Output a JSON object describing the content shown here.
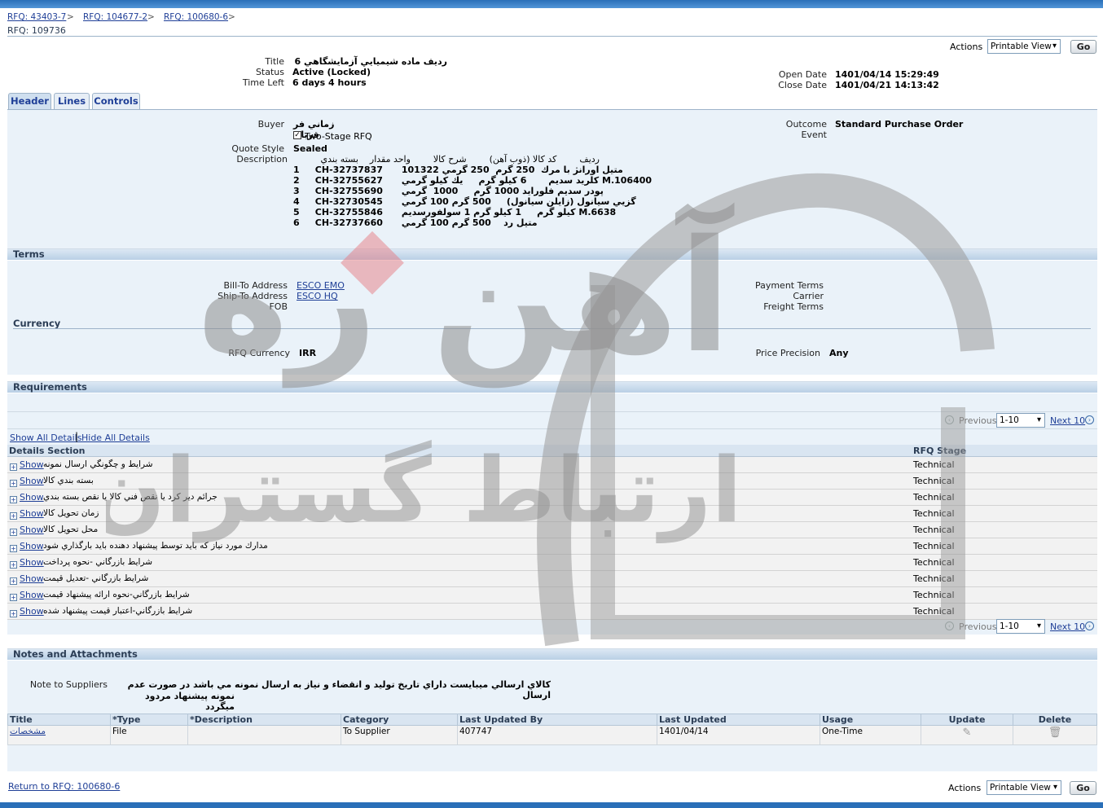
{
  "breadcrumbs": [
    "RFQ: 43403-7",
    "RFQ: 104677-2",
    "RFQ: 100680-6"
  ],
  "page_title": "RFQ: 109736",
  "actions": {
    "label": "Actions",
    "selected": "Printable View",
    "go": "Go"
  },
  "summary": {
    "title_label": "Title",
    "title": "رديف ماده شيميايي آزمايشگاهي 6",
    "status_label": "Status",
    "status": "Active (Locked)",
    "timeleft_label": "Time Left",
    "timeleft": "6 days 4 hours",
    "open_label": "Open Date",
    "open": "1401/04/14 15:29:49",
    "close_label": "Close Date",
    "close": "1401/04/21 14:13:42"
  },
  "tabs": [
    "Header",
    "Lines",
    "Controls"
  ],
  "header": {
    "buyer_label": "Buyer",
    "buyer": "زماني فر قربان",
    "two_stage": "Two-Stage RFQ",
    "quote_style_label": "Quote Style",
    "quote_style": "Sealed",
    "description_label": "Description",
    "outcome_label": "Outcome",
    "outcome": "Standard Purchase Order",
    "event_label": "Event",
    "desc_header": "رديف        كد كالا (ذوب آهن)        شرح كالا        واحد مقدار    بسته بندي",
    "desc_lines": [
      "1     CH-32737837      متيل اورانژ با مرك  250 گرم  250 گرمي 101322",
      "2     CH-32755627      كلريد سديم       6 كيلو گرم     يك كيلو گرمي M.106400",
      "3     CH-32755690      پودر سديم فلورايد 1000 گرم     1000  گرمي",
      "4     CH-32730545      گزيي سيانول (زايلن سيانول)     500 گرم 100 گرمي",
      "5     CH-32755846      كيلو گرم     1 كيلو گرم 1 سولفورسديم M.6638",
      "6     CH-32737660      متيل رد    500 گرم 100 گرمي"
    ]
  },
  "terms": {
    "section": "Terms",
    "billto_label": "Bill-To Address",
    "billto": "ESCO EMO",
    "shipto_label": "Ship-To Address",
    "shipto": "ESCO HQ",
    "fob_label": "FOB",
    "payment_label": "Payment Terms",
    "carrier_label": "Carrier",
    "freight_label": "Freight Terms",
    "currency_section": "Currency",
    "currency_label": "RFQ Currency",
    "currency": "IRR",
    "precision_label": "Price Precision",
    "precision": "Any"
  },
  "requirements": {
    "section": "Requirements",
    "previous": "Previous",
    "range": "1-10",
    "next": "Next 10",
    "show_all": "Show All Details",
    "hide_all": "Hide All Details",
    "col_details": "Details Section",
    "col_stage": "RFQ Stage",
    "show": "Show",
    "rows": [
      {
        "text": "شرايط و چگونگي ارسال نمونه",
        "stage": "Technical"
      },
      {
        "text": "بسته بندي كالا",
        "stage": "Technical"
      },
      {
        "text": "جرائم دير كرد يا نقص فني كالا يا نقص بسته بندي",
        "stage": "Technical"
      },
      {
        "text": "زمان تحويل كالا",
        "stage": "Technical"
      },
      {
        "text": "محل تحويل كالا",
        "stage": "Technical"
      },
      {
        "text": "مدارك مورد نياز كه بايد توسط پيشنهاد دهنده بايد بارگذاري شود",
        "stage": "Technical"
      },
      {
        "text": "شرايط بازرگاني -نحوه پرداخت",
        "stage": "Technical"
      },
      {
        "text": "شرايط بازرگاني -تعديل قيمت",
        "stage": "Technical"
      },
      {
        "text": "شرايط بازرگاني-نحوه ارائه پيشنهاد قيمت",
        "stage": "Technical"
      },
      {
        "text": "شرايط بازرگاني-اعتبار قيمت پيشنهاد شده",
        "stage": "Technical"
      }
    ]
  },
  "notes": {
    "section": "Notes and Attachments",
    "note_label": "Note to Suppliers",
    "note_line1": "كالاي ارسالي ميبايست داراي تاريخ توليد و انقضاء  و نياز به ارسال نمونه مي باشد در صورت عدم ارسال",
    "note_line2": "نمونه پيشنهاد مردود ميگردد",
    "columns": [
      "Title",
      "*Type",
      "*Description",
      "Category",
      "Last Updated By",
      "Last Updated",
      "Usage",
      "Update",
      "Delete"
    ],
    "row": {
      "title": "مشخصات",
      "type": "File",
      "description": "",
      "category": "To Supplier",
      "updated_by": "407747",
      "updated": "1401/04/14",
      "usage": "One-Time"
    }
  },
  "footer": {
    "return_link": "Return to RFQ: 100680-6"
  },
  "watermark": {
    "text1": "آهن ره",
    "text2": "ارتباط گستران"
  }
}
